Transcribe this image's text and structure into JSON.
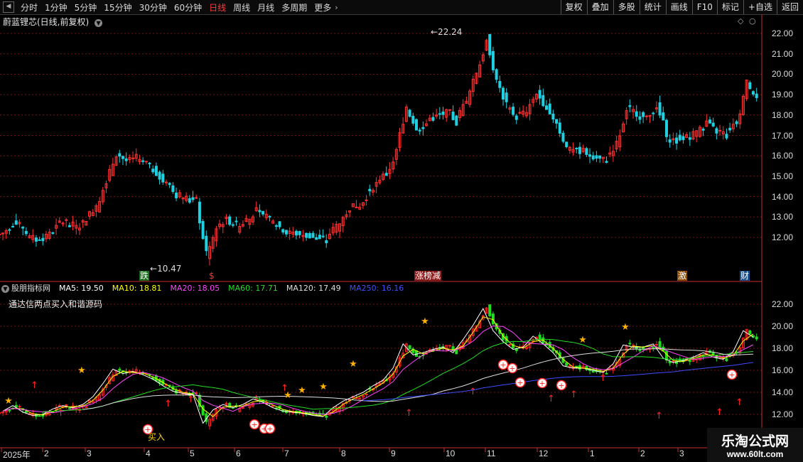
{
  "toolbar": {
    "left_items": [
      "分时",
      "1分钟",
      "5分钟",
      "15分钟",
      "30分钟",
      "60分钟",
      "日线",
      "周线",
      "月线",
      "多周期",
      "更多"
    ],
    "active": "日线",
    "right_items": [
      "复权",
      "叠加",
      "多股",
      "统计",
      "画线",
      "F10",
      "标记",
      "+自选",
      "返回"
    ]
  },
  "main_chart": {
    "title": "蔚蓝锂芯(日线,前复权)",
    "y_ticks": [
      "22.00",
      "21.00",
      "20.00",
      "19.00",
      "18.00",
      "17.00",
      "16.00",
      "15.00",
      "14.00",
      "13.00",
      "12.00"
    ],
    "high_label": "22.24",
    "low_label": "10.47",
    "event_tags": [
      "跌",
      "$",
      "涨榜减",
      "激",
      "财"
    ]
  },
  "indicator": {
    "name": "股朋指标网",
    "ma": [
      {
        "label": "MA5: 19.50",
        "color": "#ffffff"
      },
      {
        "label": "MA10: 18.81",
        "color": "#ffff00"
      },
      {
        "label": "MA20: 18.05",
        "color": "#ff44ff"
      },
      {
        "label": "MA60: 17.71",
        "color": "#22dd22"
      },
      {
        "label": "MA120: 17.49",
        "color": "#dddddd"
      },
      {
        "label": "MA250: 16.16",
        "color": "#3d4dff"
      }
    ],
    "subtitle": "通达信两点买入和谐源码",
    "y_ticks": [
      "22.00",
      "20.00",
      "18.00",
      "16.00",
      "14.00",
      "12.00"
    ],
    "buy_label": "买入"
  },
  "x_axis": [
    "2025年",
    "2",
    "3",
    "4",
    "5",
    "6",
    "7",
    "8",
    "9",
    "10",
    "11",
    "12",
    "1",
    "2",
    "3"
  ],
  "watermark": {
    "title": "乐淘公式网",
    "url": "www.60lt.com"
  },
  "chart_data": {
    "type": "candlestick",
    "series_name": "蔚蓝锂芯(日线,前复权)",
    "x_range": [
      "2025年",
      "3"
    ],
    "closes": [
      12.3,
      12.8,
      12.2,
      11.9,
      12.0,
      12.5,
      12.8,
      12.6,
      12.9,
      13.6,
      14.8,
      16.1,
      15.7,
      15.9,
      15.6,
      15.2,
      14.6,
      14.1,
      13.9,
      13.8,
      11.2,
      12.4,
      12.9,
      12.6,
      12.9,
      13.4,
      13.1,
      12.6,
      12.3,
      12.2,
      12.1,
      11.9,
      11.8,
      12.6,
      13.2,
      13.6,
      14.0,
      14.6,
      15.1,
      16.2,
      18.4,
      17.4,
      17.6,
      17.9,
      18.1,
      17.6,
      18.8,
      20.1,
      21.6,
      19.6,
      18.6,
      17.9,
      18.1,
      19.1,
      18.4,
      17.6,
      16.4,
      16.2,
      16.2,
      16.0,
      15.8,
      16.6,
      18.3,
      18.1,
      18.1,
      18.4,
      17.1,
      16.7,
      16.9,
      17.2,
      17.6,
      17.2,
      17.0,
      17.7,
      19.6,
      19.0
    ]
  }
}
